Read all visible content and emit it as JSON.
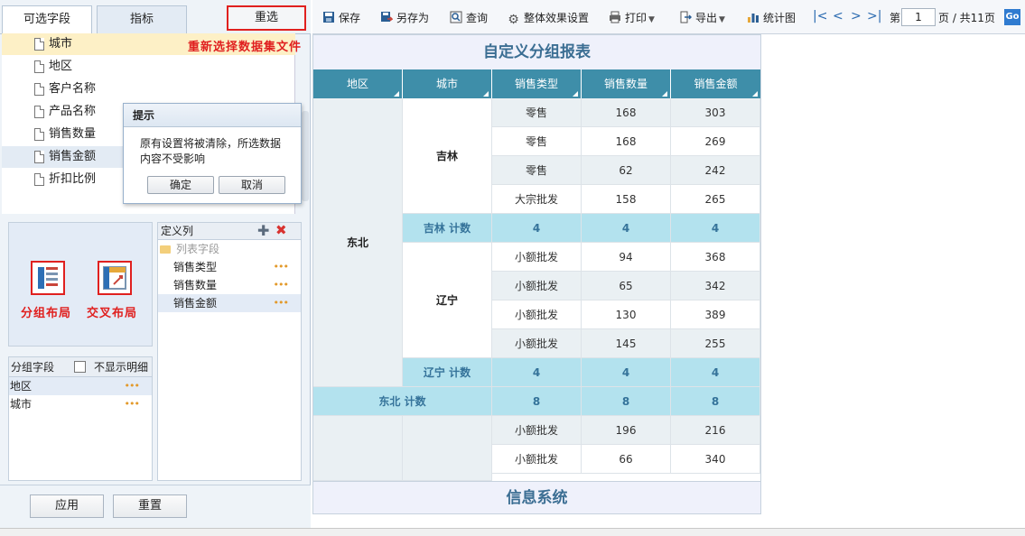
{
  "left": {
    "tabs": [
      {
        "label": "可选字段"
      },
      {
        "label": "指标"
      }
    ],
    "reselect_button": "重选",
    "reselect_hint": "重新选择数据集文件",
    "fields": [
      {
        "label": "城市"
      },
      {
        "label": "地区"
      },
      {
        "label": "客户名称"
      },
      {
        "label": "产品名称"
      },
      {
        "label": "销售数量"
      },
      {
        "label": "销售金额"
      },
      {
        "label": "折扣比例"
      }
    ],
    "dialog": {
      "title": "提示",
      "message": "原有设置将被清除，所选数据内容不受影响",
      "ok": "确定",
      "cancel": "取消"
    },
    "layouts": {
      "group": "分组布局",
      "cross": "交叉布局"
    },
    "group_fields": {
      "header": "分组字段",
      "hide_detail": "不显示明细",
      "items": [
        {
          "label": "地区"
        },
        {
          "label": "城市"
        }
      ]
    },
    "define_columns": {
      "header": "定义列",
      "folder": "列表字段",
      "items": [
        {
          "label": "销售类型"
        },
        {
          "label": "销售数量"
        },
        {
          "label": "销售金额"
        }
      ]
    },
    "apply_button": "应用",
    "reset_button": "重置"
  },
  "toolbar": {
    "save": "保存",
    "save_as": "另存为",
    "query": "查询",
    "effects": "整体效果设置",
    "print": "打印",
    "export": "导出",
    "stats": "统计图",
    "page_prefix": "第",
    "page_value": "1",
    "page_suffix": "页 / 共11页",
    "go": "Go"
  },
  "report": {
    "title": "自定义分组报表",
    "footer": "信息系统",
    "headers": [
      "地区",
      "城市",
      "销售类型",
      "销售数量",
      "销售金额"
    ],
    "region": "东北",
    "cities": [
      {
        "name": "吉林",
        "rows": [
          [
            "零售",
            "168",
            "303"
          ],
          [
            "零售",
            "168",
            "269"
          ],
          [
            "零售",
            "62",
            "242"
          ],
          [
            "大宗批发",
            "158",
            "265"
          ]
        ],
        "subtotal": {
          "label": "吉林 计数",
          "values": [
            "4",
            "4",
            "4"
          ]
        }
      },
      {
        "name": "辽宁",
        "rows": [
          [
            "小额批发",
            "94",
            "368"
          ],
          [
            "小额批发",
            "65",
            "342"
          ],
          [
            "小额批发",
            "130",
            "389"
          ],
          [
            "小额批发",
            "145",
            "255"
          ]
        ],
        "subtotal": {
          "label": "辽宁 计数",
          "values": [
            "4",
            "4",
            "4"
          ]
        }
      }
    ],
    "region_total": {
      "label": "东北 计数",
      "values": [
        "8",
        "8",
        "8"
      ]
    },
    "tail_rows": [
      [
        "小额批发",
        "196",
        "216"
      ],
      [
        "小额批发",
        "66",
        "340"
      ]
    ]
  }
}
